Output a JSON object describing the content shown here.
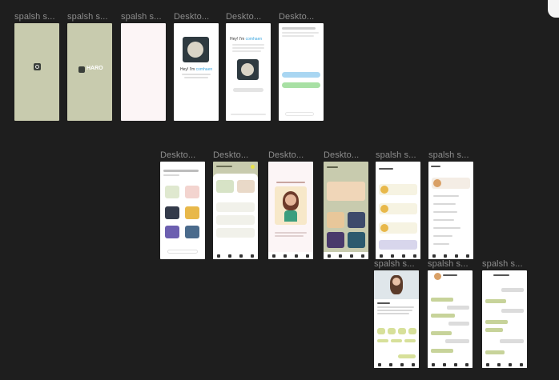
{
  "canvas": {
    "background": "#1e1e1e",
    "label_color": "#8d8d8d"
  },
  "frames": {
    "f1": {
      "label": "spalsh s..."
    },
    "f2": {
      "label": "spalsh s...",
      "logo_text": "HARO"
    },
    "f3": {
      "label": "spalsh s..."
    },
    "f4": {
      "label": "Deskto...",
      "greeting": "Hey! I'm",
      "brand": "comhaen"
    },
    "f5": {
      "label": "Deskto...",
      "greeting": "Hey! I'm",
      "brand": "comhaen"
    },
    "f6": {
      "label": "Deskto..."
    },
    "f7": {
      "label": "Deskto..."
    },
    "f8": {
      "label": "Deskto..."
    },
    "f9": {
      "label": "Deskto..."
    },
    "f10": {
      "label": "Deskto..."
    },
    "f11": {
      "label": "spalsh s..."
    },
    "f12": {
      "label": "spalsh s..."
    },
    "f13": {
      "label": "spalsh s..."
    },
    "f14": {
      "label": "spalsh s..."
    },
    "f15": {
      "label": "spalsh s..."
    }
  },
  "colors": {
    "sage": "#c8cbae",
    "blush": "#fcf5f6",
    "accent_blue": "#3da7e0",
    "pill_blue": "#a9d6f2",
    "pill_green": "#a8e0a4",
    "chat_green": "#c7d39a"
  },
  "icons": {
    "splash_logo": "app-logo-icon",
    "nav": [
      "home-icon",
      "heart-icon",
      "car-icon",
      "settings-icon"
    ]
  }
}
